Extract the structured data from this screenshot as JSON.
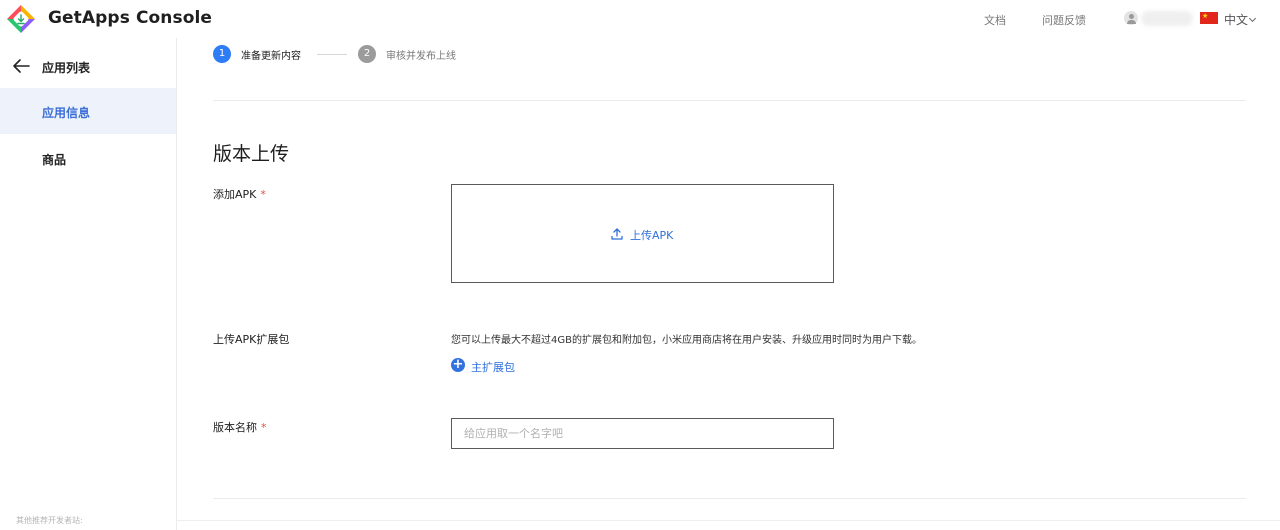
{
  "header": {
    "brand": "GetApps Console",
    "docs_link": "文档",
    "feedback_link": "问题反馈",
    "language": "中文",
    "logo_icon": "getapps-logo-icon",
    "flag_icon": "china-flag-icon"
  },
  "sidebar": {
    "back_label": "应用列表",
    "items": [
      {
        "label": "应用信息",
        "active": true
      },
      {
        "label": "商品",
        "active": false
      }
    ],
    "footer_text": "其他推荐开发者站:"
  },
  "steps": [
    {
      "number": "1",
      "label": "准备更新内容",
      "active": true
    },
    {
      "number": "2",
      "label": "审核并发布上线",
      "active": false
    }
  ],
  "form": {
    "section_title": "版本上传",
    "apk_label": "添加APK",
    "required_mark": "*",
    "upload_button": "上传APK",
    "ext_label": "上传APK扩展包",
    "ext_description": "您可以上传最大不超过4GB的扩展包和附加包，小米应用商店将在用户安装、升级应用时同时为用户下载。",
    "add_main_ext": "主扩展包",
    "version_label": "版本名称",
    "version_placeholder": "给应用取一个名字吧",
    "version_value": ""
  },
  "colors": {
    "accent": "#2e7cf6",
    "link": "#2f6fdc",
    "active_nav_bg": "#edf2fb",
    "required": "#e34d3f"
  }
}
